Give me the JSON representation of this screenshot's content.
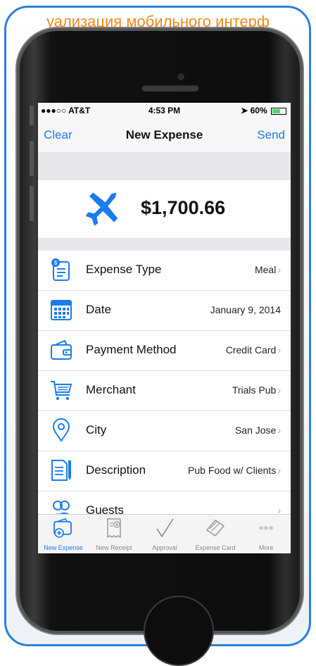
{
  "banner": "уализация мобильного интерф",
  "status": {
    "carrier": "●●●○○ AT&T",
    "time": "4:53 PM",
    "battery": "60%"
  },
  "nav": {
    "left": "Clear",
    "title": "New Expense",
    "right": "Send"
  },
  "amount": {
    "value": "$1,700.66",
    "icon": "airplane-icon"
  },
  "rows": [
    {
      "label": "Expense Type",
      "value": "Meal",
      "chevron": true,
      "icon": "expense-type-icon"
    },
    {
      "label": "Date",
      "value": "January 9, 2014",
      "chevron": false,
      "icon": "calendar-icon"
    },
    {
      "label": "Payment Method",
      "value": "Credit Card",
      "chevron": true,
      "icon": "wallet-icon"
    },
    {
      "label": "Merchant",
      "value": "Trials Pub",
      "chevron": true,
      "icon": "cart-icon"
    },
    {
      "label": "City",
      "value": "San Jose",
      "chevron": true,
      "icon": "location-pin-icon"
    },
    {
      "label": "Description",
      "value": "Pub Food w/ Clients",
      "chevron": true,
      "icon": "document-icon"
    },
    {
      "label": "Guests",
      "value": "",
      "chevron": true,
      "icon": "guests-icon"
    }
  ],
  "tabs": [
    {
      "label": "New Expense",
      "active": true,
      "icon": "wallet-add-icon"
    },
    {
      "label": "New Receipt",
      "active": false,
      "icon": "receipt-add-icon"
    },
    {
      "label": "Approval",
      "active": false,
      "icon": "checkmark-icon"
    },
    {
      "label": "Expense Card",
      "active": false,
      "icon": "card-icon"
    },
    {
      "label": "More",
      "active": false,
      "icon": "more-icon"
    }
  ],
  "colors": {
    "accent": "#1a7cf0",
    "banner": "#f08a1c",
    "frame": "#2e7fd9"
  }
}
